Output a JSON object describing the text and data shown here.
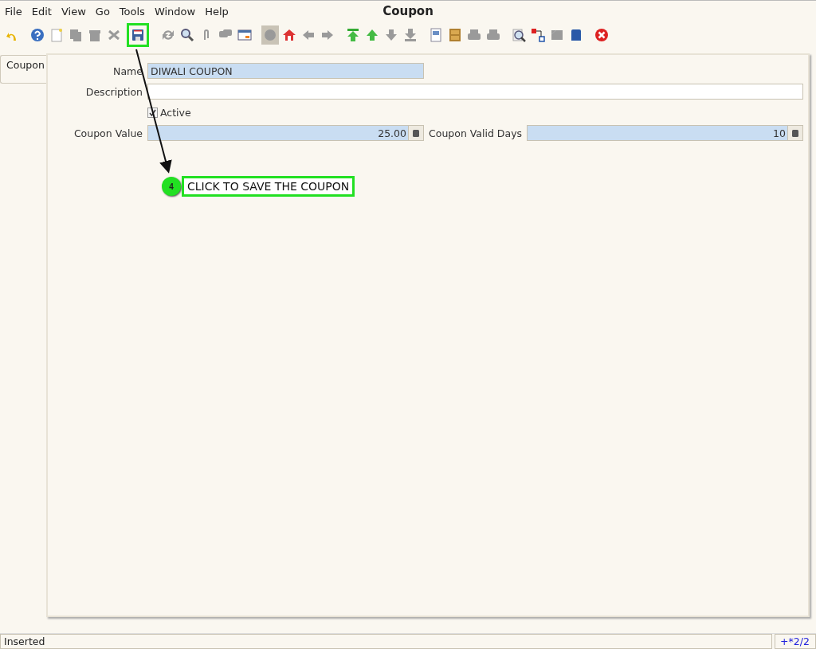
{
  "window": {
    "title": "Coupon"
  },
  "menu": [
    "File",
    "Edit",
    "View",
    "Go",
    "Tools",
    "Window",
    "Help"
  ],
  "toolbar": [
    {
      "kind": "undo",
      "disabled": false,
      "highlighted": false,
      "pressed": false
    },
    {
      "kind": "help",
      "disabled": false,
      "highlighted": false,
      "pressed": false
    },
    {
      "kind": "new",
      "disabled": false,
      "highlighted": false,
      "pressed": false
    },
    {
      "kind": "copy",
      "disabled": true,
      "highlighted": false,
      "pressed": false
    },
    {
      "kind": "delete",
      "disabled": true,
      "highlighted": false,
      "pressed": false
    },
    {
      "kind": "cross",
      "disabled": true,
      "highlighted": false,
      "pressed": false
    },
    {
      "kind": "save",
      "disabled": false,
      "highlighted": true,
      "pressed": false
    },
    {
      "kind": "refresh",
      "disabled": true,
      "highlighted": false,
      "pressed": false
    },
    {
      "kind": "find",
      "disabled": false,
      "highlighted": false,
      "pressed": false
    },
    {
      "kind": "attach",
      "disabled": true,
      "highlighted": false,
      "pressed": false
    },
    {
      "kind": "chat",
      "disabled": true,
      "highlighted": false,
      "pressed": false
    },
    {
      "kind": "grid",
      "disabled": false,
      "highlighted": false,
      "pressed": false
    },
    {
      "kind": "history",
      "disabled": true,
      "highlighted": false,
      "pressed": true
    },
    {
      "kind": "home",
      "disabled": false,
      "highlighted": false,
      "pressed": false
    },
    {
      "kind": "left",
      "disabled": true,
      "highlighted": false,
      "pressed": false
    },
    {
      "kind": "right",
      "disabled": true,
      "highlighted": false,
      "pressed": false
    },
    {
      "kind": "first",
      "disabled": false,
      "highlighted": false,
      "pressed": false
    },
    {
      "kind": "up",
      "disabled": false,
      "highlighted": false,
      "pressed": false
    },
    {
      "kind": "down",
      "disabled": true,
      "highlighted": false,
      "pressed": false
    },
    {
      "kind": "last",
      "disabled": true,
      "highlighted": false,
      "pressed": false
    },
    {
      "kind": "report",
      "disabled": false,
      "highlighted": false,
      "pressed": false
    },
    {
      "kind": "archive",
      "disabled": false,
      "highlighted": false,
      "pressed": false
    },
    {
      "kind": "print",
      "disabled": true,
      "highlighted": false,
      "pressed": false
    },
    {
      "kind": "print",
      "disabled": true,
      "highlighted": false,
      "pressed": false
    },
    {
      "kind": "zoom",
      "disabled": false,
      "highlighted": false,
      "pressed": false
    },
    {
      "kind": "workflow",
      "disabled": false,
      "highlighted": false,
      "pressed": false
    },
    {
      "kind": "process",
      "disabled": true,
      "highlighted": false,
      "pressed": false
    },
    {
      "kind": "product",
      "disabled": false,
      "highlighted": false,
      "pressed": false
    },
    {
      "kind": "close",
      "disabled": false,
      "highlighted": false,
      "pressed": false
    }
  ],
  "tabs": [
    {
      "label": "Coupon",
      "selected": true
    }
  ],
  "form": {
    "name": {
      "label": "Name",
      "value": "DIWALI COUPON"
    },
    "description": {
      "label": "Description"
    },
    "active": {
      "label": "Active",
      "checked": true
    },
    "coupon_value": {
      "label": "Coupon Value",
      "value": "25.00"
    },
    "valid_days": {
      "label": "Coupon Valid Days",
      "value": "10"
    }
  },
  "callout": {
    "step": "4",
    "text": "CLICK TO SAVE THE COUPON"
  },
  "status_bar": {
    "message": "Inserted",
    "record": "+*2/2"
  }
}
